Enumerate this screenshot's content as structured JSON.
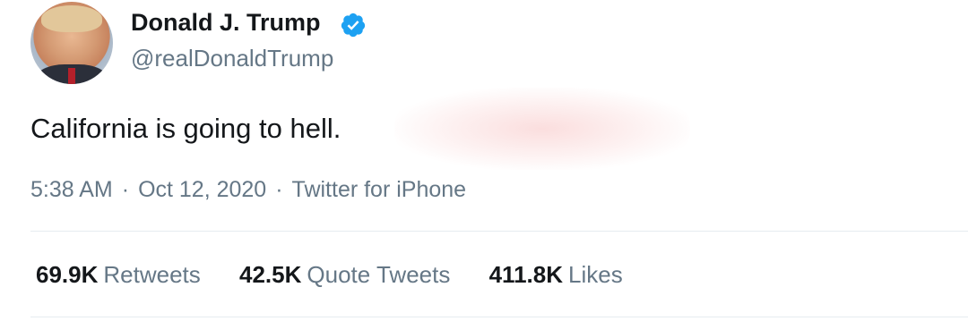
{
  "author": {
    "name": "Donald J. Trump",
    "handle": "@realDonaldTrump",
    "verified_icon": "verified-badge-icon"
  },
  "tweet": {
    "text": "California is going to hell."
  },
  "meta": {
    "time": "5:38 AM",
    "separator": "·",
    "date": "Oct 12, 2020",
    "source": "Twitter for iPhone"
  },
  "stats": [
    {
      "count": "69.9K",
      "label": "Retweets"
    },
    {
      "count": "42.5K",
      "label": "Quote Tweets"
    },
    {
      "count": "411.8K",
      "label": "Likes"
    }
  ],
  "colors": {
    "text": "#14171a",
    "secondary": "#657786",
    "verified": "#1da1f2",
    "divider": "#e6ecf0"
  }
}
